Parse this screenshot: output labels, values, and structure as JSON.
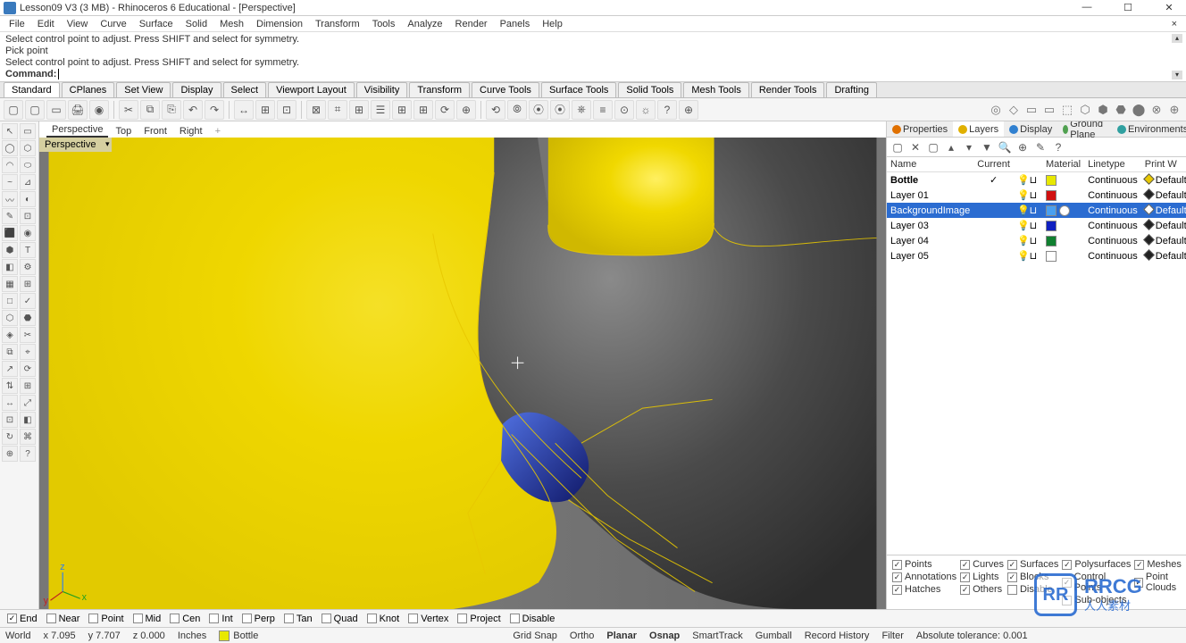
{
  "title": "Lesson09 V3 (3 MB) - Rhinoceros 6 Educational - [Perspective]",
  "winbtns": {
    "min": "—",
    "max": "☐",
    "close": "✕"
  },
  "menus": [
    "File",
    "Edit",
    "View",
    "Curve",
    "Surface",
    "Solid",
    "Mesh",
    "Dimension",
    "Transform",
    "Tools",
    "Analyze",
    "Render",
    "Panels",
    "Help"
  ],
  "cmd": {
    "l1": "Select control point to adjust. Press SHIFT and select for symmetry.",
    "l2": "Pick point",
    "l3": "Select control point to adjust. Press SHIFT and select for symmetry.",
    "prompt": "Command:"
  },
  "tabs": [
    "Standard",
    "CPlanes",
    "Set View",
    "Display",
    "Select",
    "Viewport Layout",
    "Visibility",
    "Transform",
    "Curve Tools",
    "Surface Tools",
    "Solid Tools",
    "Mesh Tools",
    "Render Tools",
    "Drafting"
  ],
  "vtabs": [
    "Perspective",
    "Top",
    "Front",
    "Right",
    "+"
  ],
  "vlabel": "Perspective",
  "ptabs": [
    "Properties",
    "Layers",
    "Display",
    "Ground Plane",
    "Environments"
  ],
  "layercols": [
    "Name",
    "Current",
    "",
    "Material",
    "Linetype",
    "Print W"
  ],
  "layers": [
    {
      "name": "Bottle",
      "current": "✓",
      "color": "#e8e800",
      "linetype": "Continuous",
      "diam": "#e8c800",
      "pw": "Default"
    },
    {
      "name": "Layer 01",
      "current": "",
      "color": "#d01010",
      "linetype": "Continuous",
      "diam": "#222",
      "pw": "Default"
    },
    {
      "name": "BackgroundImage",
      "current": "",
      "color": "#4aa0f0",
      "linetype": "Continuous",
      "diam": "#fff",
      "pw": "Default",
      "sel": true
    },
    {
      "name": "Layer 03",
      "current": "",
      "color": "#1020c0",
      "linetype": "Continuous",
      "diam": "#222",
      "pw": "Default"
    },
    {
      "name": "Layer 04",
      "current": "",
      "color": "#108030",
      "linetype": "Continuous",
      "diam": "#222",
      "pw": "Default"
    },
    {
      "name": "Layer 05",
      "current": "",
      "color": "#fff",
      "linetype": "Continuous",
      "diam": "#222",
      "pw": "Default"
    }
  ],
  "filters": [
    [
      "Points",
      "Annotations",
      "Hatches"
    ],
    [
      "Curves",
      "Lights",
      "Others"
    ],
    [
      "Surfaces",
      "Blocks",
      "Disable"
    ],
    [
      "Polysurfaces",
      "Control Points",
      "Sub-objects"
    ],
    [
      "Meshes",
      "Point Clouds"
    ]
  ],
  "filters_checked": [
    "Points",
    "Annotations",
    "Hatches",
    "Curves",
    "Lights",
    "Others",
    "Surfaces",
    "Blocks",
    "Polysurfaces",
    "Control Points",
    "Meshes",
    "Point Clouds"
  ],
  "snaps": [
    "End",
    "Near",
    "Point",
    "Mid",
    "Cen",
    "Int",
    "Perp",
    "Tan",
    "Quad",
    "Knot",
    "Vertex",
    "Project",
    "Disable"
  ],
  "snaps_checked": [
    "End"
  ],
  "status": {
    "world": "World",
    "x": "x 7.095",
    "y": "y 7.707",
    "z": "z 0.000",
    "units": "Inches",
    "layer_sw": "#e8e800",
    "layer": "Bottle",
    "grid": "Grid Snap",
    "ortho": "Ortho",
    "planar": "Planar",
    "osnap": "Osnap",
    "smart": "SmartTrack",
    "gumball": "Gumball",
    "rec": "Record History",
    "filter": "Filter",
    "tol": "Absolute tolerance: 0.001"
  },
  "logo": {
    "txt": "RRCG",
    "sub": "人人素材"
  }
}
